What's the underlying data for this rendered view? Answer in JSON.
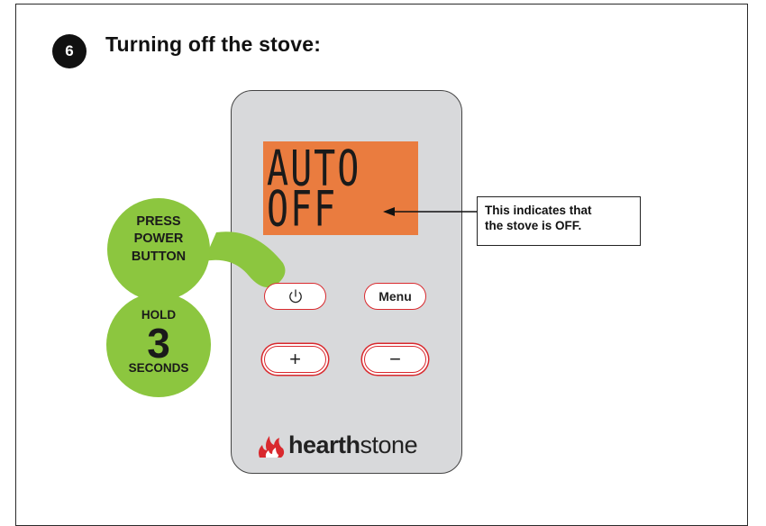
{
  "step": {
    "number": "6",
    "title": "Turning off the stove:"
  },
  "display": {
    "line1": "AUTO",
    "line2": "OFF",
    "color": "#ea7c3f"
  },
  "callout": {
    "line1": "This indicates that",
    "line2": "the stove is OFF."
  },
  "instruction_press": {
    "line1": "PRESS",
    "line2": "POWER",
    "line3": "BUTTON"
  },
  "instruction_hold": {
    "top": "HOLD",
    "number": "3",
    "bottom": "SECONDS"
  },
  "buttons": {
    "power_icon": "power-icon",
    "menu_label": "Menu",
    "plus_glyph": "+",
    "minus_glyph": "−"
  },
  "brand": {
    "bold": "hearth",
    "light": "stone",
    "icon": "flame-icon",
    "accent": "#d9292e"
  },
  "colors": {
    "bubble_green": "#8cc63f",
    "remote_body": "#d8d9db"
  }
}
